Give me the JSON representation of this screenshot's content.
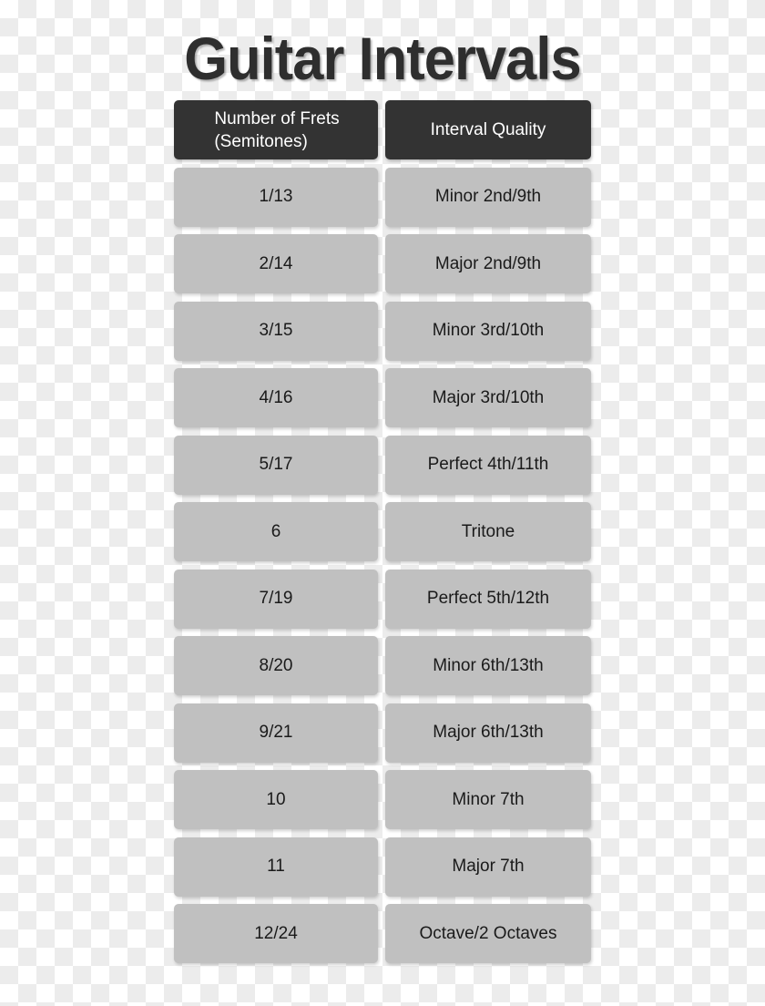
{
  "page": {
    "title": "Guitar Intervals",
    "background_checker_light": "#ffffff",
    "background_checker_dark": "#ececec"
  },
  "colors": {
    "title_text": "#2e2e2e",
    "header_background": "#333333",
    "header_text": "#ffffff",
    "cell_background": "#c0c0c0",
    "cell_text": "#1a1a1a"
  },
  "table": {
    "headers": {
      "frets_line1": "Number of Frets",
      "frets_line2": "(Semitones)",
      "quality": "Interval Quality"
    },
    "rows": [
      {
        "frets": "1/13",
        "quality": "Minor 2nd/9th"
      },
      {
        "frets": "2/14",
        "quality": "Major 2nd/9th"
      },
      {
        "frets": "3/15",
        "quality": "Minor 3rd/10th"
      },
      {
        "frets": "4/16",
        "quality": "Major 3rd/10th"
      },
      {
        "frets": "5/17",
        "quality": "Perfect 4th/11th"
      },
      {
        "frets": "6",
        "quality": "Tritone"
      },
      {
        "frets": "7/19",
        "quality": "Perfect 5th/12th"
      },
      {
        "frets": "8/20",
        "quality": "Minor 6th/13th"
      },
      {
        "frets": "9/21",
        "quality": "Major 6th/13th"
      },
      {
        "frets": "10",
        "quality": "Minor 7th"
      },
      {
        "frets": "11",
        "quality": "Major 7th"
      },
      {
        "frets": "12/24",
        "quality": "Octave/2 Octaves"
      }
    ]
  }
}
